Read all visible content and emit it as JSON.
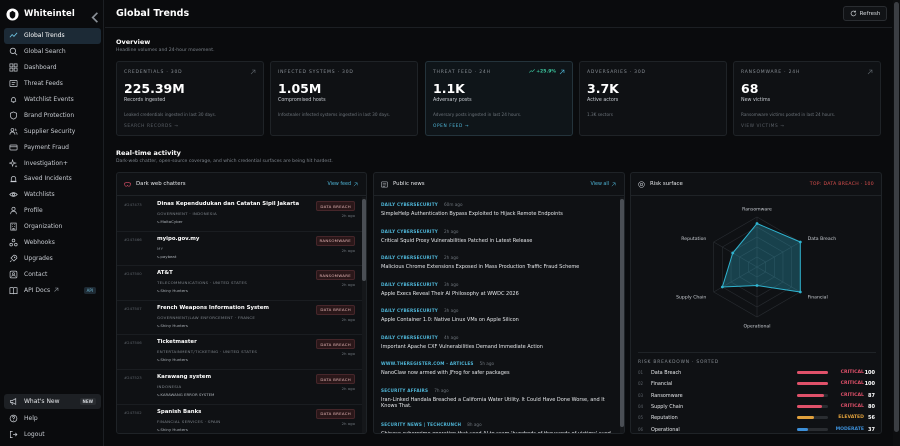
{
  "brand": {
    "name": "Whiteintel"
  },
  "sidebar": {
    "items": [
      {
        "label": "Global Trends",
        "icon": "trends-icon"
      },
      {
        "label": "Global Search",
        "icon": "search-icon"
      },
      {
        "label": "Dashboard",
        "icon": "dashboard-icon"
      },
      {
        "label": "Threat Feeds",
        "icon": "feeds-icon"
      },
      {
        "label": "Watchlist Events",
        "icon": "bell-icon"
      },
      {
        "label": "Brand Protection",
        "icon": "shield-icon"
      },
      {
        "label": "Supplier Security",
        "icon": "users-icon"
      },
      {
        "label": "Payment Fraud",
        "icon": "card-icon"
      },
      {
        "label": "Investigation+",
        "icon": "sparkle-icon"
      },
      {
        "label": "Saved Incidents",
        "icon": "siren-icon"
      },
      {
        "label": "Watchlists",
        "icon": "eye-icon"
      },
      {
        "label": "Profile",
        "icon": "user-icon"
      },
      {
        "label": "Organization",
        "icon": "building-icon"
      },
      {
        "label": "Webhooks",
        "icon": "webhook-icon"
      },
      {
        "label": "Upgrades",
        "icon": "rocket-icon"
      },
      {
        "label": "Contact",
        "icon": "contact-icon"
      },
      {
        "label": "API Docs",
        "icon": "book-icon",
        "badge": "API"
      }
    ],
    "whats_new": "What's New",
    "new_badge": "NEW",
    "help": "Help",
    "logout": "Logout"
  },
  "header": {
    "title": "Global Trends",
    "refresh": "Refresh"
  },
  "overview": {
    "title": "Overview",
    "subtitle": "Headline volumes and 24-hour movement.",
    "cards": [
      {
        "label": "CREDENTIALS · 30D",
        "value": "225.39M",
        "desc": "Records ingested",
        "note": "Leaked credentials ingested in last 30 days.",
        "link": "SEARCH RECORDS →"
      },
      {
        "label": "INFECTED SYSTEMS · 30D",
        "value": "1.05M",
        "desc": "Compromised hosts",
        "note": "Infostealer infected systems ingested in last 30 days.",
        "link": ""
      },
      {
        "label": "THREAT FEED · 24H",
        "delta": "+25.9%",
        "value": "1.1K",
        "desc": "Adversary posts",
        "note": "Adversary posts ingested in last 24 hours.",
        "link": "OPEN FEED →"
      },
      {
        "label": "ADVERSARIES · 30D",
        "value": "3.7K",
        "desc": "Active actors",
        "note": "1.3K sectors",
        "link": ""
      },
      {
        "label": "RANSOMWARE · 24H",
        "value": "68",
        "desc": "New victims",
        "note": "Ransomware victims posted in last 24 hours.",
        "link": "VIEW VICTIMS →"
      }
    ]
  },
  "realtime": {
    "title": "Real-time activity",
    "subtitle": "Dark-web chatter, open-source coverage, and which credential surfaces are being hit hardest."
  },
  "chatter": {
    "title": "Dark web chatters",
    "view": "View feed",
    "rows": [
      {
        "id": "#247473",
        "org": "Dinas Kependudukan dan Catatan Sipil Jakarta",
        "meta": "GOVERNMENT · INDONESIA",
        "actor": "⤷ MaltaCyber",
        "tag": "DATA BREACH",
        "ago": "2h ago"
      },
      {
        "id": "#247466",
        "org": "myipo.gov.my",
        "meta": "MY",
        "actor": "⤷ paybeat",
        "tag": "RANSOMWARE",
        "ago": "2h ago"
      },
      {
        "id": "#247500",
        "org": "AT&T",
        "meta": "TELECOMMUNICATIONS · UNITED STATES",
        "actor": "⤷ Shiny Hunters",
        "tag": "RANSOMWARE",
        "ago": "2h ago"
      },
      {
        "id": "#247507",
        "org": "French Weapons Information System",
        "meta": "GOVERNMENT/LAW ENFORCEMENT · FRANCE",
        "actor": "⤷ Shiny Hunters",
        "tag": "DATA BREACH",
        "ago": "2h ago"
      },
      {
        "id": "#247506",
        "org": "Ticketmaster",
        "meta": "ENTERTAINMENT/TICKETING · UNITED STATES",
        "actor": "⤷ Shiny Hunters",
        "tag": "DATA BREACH",
        "ago": "2h ago"
      },
      {
        "id": "#247523",
        "org": "Karawang system",
        "meta": "INDONESIA",
        "actor": "⤷ KARAWANG ERROR SYSTEM",
        "tag": "DATA BREACH",
        "ago": "2h ago"
      },
      {
        "id": "#247502",
        "org": "Spanish Banks",
        "meta": "FINANCIAL SERVICES · SPAIN",
        "actor": "⤷ Shiny Hunters",
        "tag": "DATA BREACH",
        "ago": "2h ago"
      }
    ]
  },
  "news": {
    "title": "Public news",
    "view": "View all",
    "items": [
      {
        "src": "DAILY CYBERSECURITY",
        "ago": "60m ago",
        "headline": "SimpleHelp Authentication Bypass Exploited to Hijack Remote Endpoints"
      },
      {
        "src": "DAILY CYBERSECURITY",
        "ago": "2h ago",
        "headline": "Critical Squid Proxy Vulnerabilities Patched in Latest Release"
      },
      {
        "src": "DAILY CYBERSECURITY",
        "ago": "2h ago",
        "headline": "Malicious Chrome Extensions Exposed in Mass Production Traffic Fraud Scheme"
      },
      {
        "src": "DAILY CYBERSECURITY",
        "ago": "3h ago",
        "headline": "Apple Execs Reveal Their AI Philosophy at WWDC 2026"
      },
      {
        "src": "DAILY CYBERSECURITY",
        "ago": "3h ago",
        "headline": "Apple Container 1.0: Native Linux VMs on Apple Silicon"
      },
      {
        "src": "DAILY CYBERSECURITY",
        "ago": "4h ago",
        "headline": "Important Apache CXF Vulnerabilities Demand Immediate Action"
      },
      {
        "src": "WWW.THEREGISTER.COM · ARTICLES",
        "ago": "5h ago",
        "headline": "NanoClaw now armed with JFrog for safer packages"
      },
      {
        "src": "SECURITY AFFAIRS",
        "ago": "7h ago",
        "headline": "Iran-Linked Handala Breached a California Water Utility. It Could Have Done Worse, and It Knows That."
      },
      {
        "src": "SECURITY NEWS | TECHCRUNCH",
        "ago": "8h ago",
        "headline": "Chinese cybercrime operation that used AI to scam 'hundreds of thousands of victims' sued"
      }
    ]
  },
  "risk": {
    "title": "Risk surface",
    "top_badge": "TOP: DATA BREACH · 100",
    "breakdown_title": "RISK BREAKDOWN · SORTED",
    "rows": [
      {
        "n": "01",
        "cat": "Data Breach",
        "level": "CRITICAL",
        "score": 100,
        "color": "#e0516a"
      },
      {
        "n": "02",
        "cat": "Financial",
        "level": "CRITICAL",
        "score": 100,
        "color": "#e0516a"
      },
      {
        "n": "03",
        "cat": "Ransomware",
        "level": "CRITICAL",
        "score": 87,
        "color": "#e0516a"
      },
      {
        "n": "04",
        "cat": "Supply Chain",
        "level": "CRITICAL",
        "score": 80,
        "color": "#e0516a"
      },
      {
        "n": "05",
        "cat": "Reputation",
        "level": "ELEVATED",
        "score": 56,
        "color": "#e0a03c"
      },
      {
        "n": "06",
        "cat": "Operational",
        "level": "MODERATE",
        "score": 37,
        "color": "#3c8fd8"
      }
    ],
    "radar": {
      "axes": [
        "Ransomware",
        "Data Breach",
        "Financial",
        "Operational",
        "Supply Chain",
        "Reputation"
      ],
      "values": [
        87,
        100,
        100,
        37,
        80,
        56
      ],
      "max": 100,
      "color": "#2fb3cf"
    }
  }
}
